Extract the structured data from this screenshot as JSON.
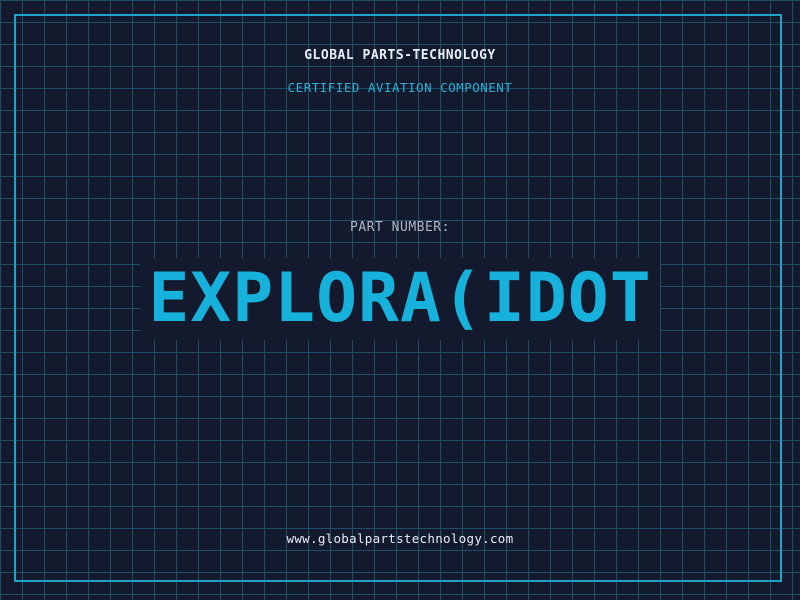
{
  "header": {
    "company": "GLOBAL PARTS-TECHNOLOGY",
    "subtitle": "CERTIFIED AVIATION COMPONENT"
  },
  "part": {
    "label": "PART NUMBER:",
    "value": "EXPLORA(IDOT"
  },
  "footer": {
    "website": "www.globalpartstechnology.com"
  },
  "colors": {
    "background": "#131a2e",
    "grid": "#1d4f67",
    "accent": "#16b2dc",
    "text": "#e8eef5",
    "muted": "#aeb6c4"
  }
}
